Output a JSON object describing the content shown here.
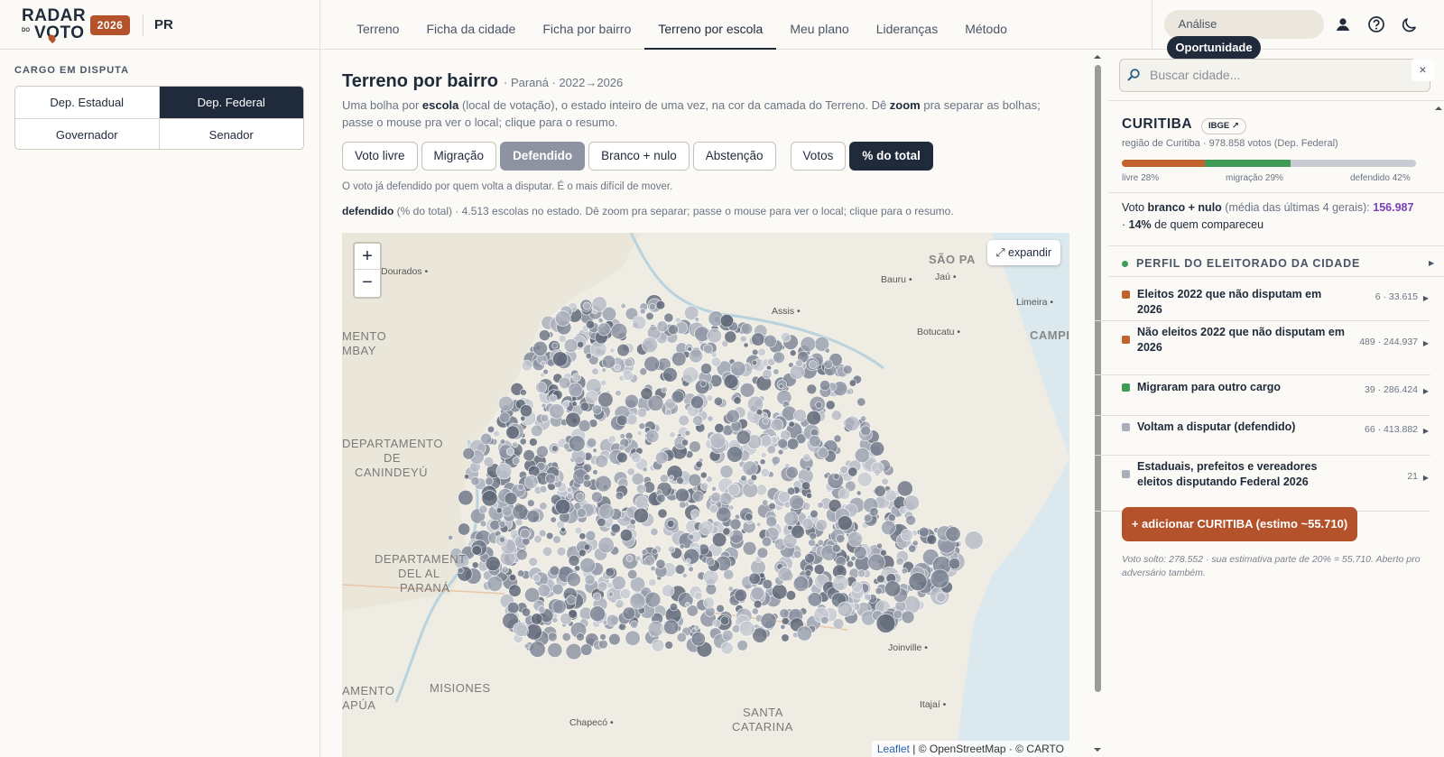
{
  "brand": {
    "line1": "RADAR",
    "line2": "VOTO",
    "small": "DO",
    "year": "2026",
    "state": "PR"
  },
  "nav": {
    "tabs": [
      "Terreno",
      "Ficha da cidade",
      "Ficha por bairro",
      "Terreno por escola",
      "Meu plano",
      "Lideranças",
      "Método"
    ],
    "active": "Terreno por escola"
  },
  "mode": {
    "analise": "Análise",
    "oportunidade": "Oportunidade",
    "active": "Oportunidade"
  },
  "sidebar": {
    "title": "CARGO EM DISPUTA",
    "options": [
      "Dep. Estadual",
      "Dep. Federal",
      "Governador",
      "Senador"
    ],
    "selected": "Dep. Federal"
  },
  "main": {
    "title": "Terreno por bairro",
    "subtitle": "· Paraná · 2022→2026",
    "desc_a": "Uma bolha por ",
    "desc_b": "escola",
    "desc_c": " (local de votação), o estado inteiro de uma vez, na cor da camada do Terreno. Dê ",
    "desc_d": "zoom",
    "desc_e": " pra separar as bolhas; passe o mouse pra ver o local; clique para o resumo.",
    "layers": [
      "Voto livre",
      "Migração",
      "Defendido",
      "Branco + nulo",
      "Abstenção"
    ],
    "active_layer": "Defendido",
    "metrics": [
      "Votos",
      "% do total"
    ],
    "active_metric": "% do total",
    "layer_note": "O voto já defendido por quem volta a disputar. É o mais difícil de mover.",
    "stat_bold": "defendido",
    "stat_rest": " (% do total) · 4.513 escolas no estado. Dê zoom pra separar; passe o mouse para ver o local; clique para o resumo."
  },
  "map": {
    "zoom_in": "+",
    "zoom_out": "−",
    "expand": "⤢ expandir",
    "attribution_leaflet": "Leaflet",
    "attribution_rest": " | © OpenStreetMap · © CARTO",
    "regions": [
      "SÃO PA",
      "CAMPI",
      "MENTO",
      "MBAY",
      "DEPARTAMENTO",
      "DE",
      "CANINDEYÚ",
      "DEPARTAMENT",
      "DEL AL",
      "PARANÁ",
      "MISIONES",
      "AMENTO",
      "APÚA",
      "SANTA",
      "CATARINA"
    ],
    "towns": [
      "Dourados",
      "Bauru",
      "Jaú",
      "Limeira",
      "Assis",
      "Botucatu",
      "Joinville",
      "Itajaí",
      "Chapecó"
    ],
    "bubble_color": "#6d7585"
  },
  "panel": {
    "search_placeholder": "Buscar cidade...",
    "close": "×",
    "city": "CURITIBA",
    "ibge": "IBGE ↗",
    "region_sub": "região de Curitiba · 978.858 votos (Dep. Federal)",
    "bar": {
      "livre": 28,
      "migracao": 29,
      "defendido": 42,
      "livre_label": "livre 28%",
      "migracao_label": "migração 29%",
      "defendido_label": "defendido 42%"
    },
    "branco_a": "Voto ",
    "branco_b": "branco + nulo",
    "branco_c": " (média das últimas 4 gerais): ",
    "branco_val": "156.987",
    "branco_d": "· ",
    "branco_pct": "14%",
    "branco_e": " de quem compareceu",
    "perfil_title": "PERFIL DO ELEITORADO DA CIDADE",
    "rows": [
      {
        "label": "Eleitos 2022 que não disputam em 2026",
        "count": "6 · 33.615",
        "color": "#c2622c"
      },
      {
        "label": "Não eleitos 2022 que não disputam em 2026",
        "count": "489 · 244.937",
        "color": "#c2622c"
      },
      {
        "label": "Migraram para outro cargo",
        "count": "39 · 286.424",
        "color": "#3e9c55"
      },
      {
        "label": "Voltam a disputar (defendido)",
        "count": "66 · 413.882",
        "color": "#a9aebb"
      },
      {
        "label": "Estaduais, prefeitos e vereadores eleitos disputando Federal 2026",
        "count": "21",
        "color": "#a9aebb"
      }
    ],
    "add_button": "+ adicionar CURITIBA (estimo ~55.710)",
    "foot": "Voto solto: 278.552 · sua estimativa parte de 20% = 55.710. Aberto pro adversário também."
  },
  "colors": {
    "brand": "#b4532b",
    "navy": "#1f2a3a",
    "green": "#3e9c55",
    "purple": "#7b3fb8"
  }
}
